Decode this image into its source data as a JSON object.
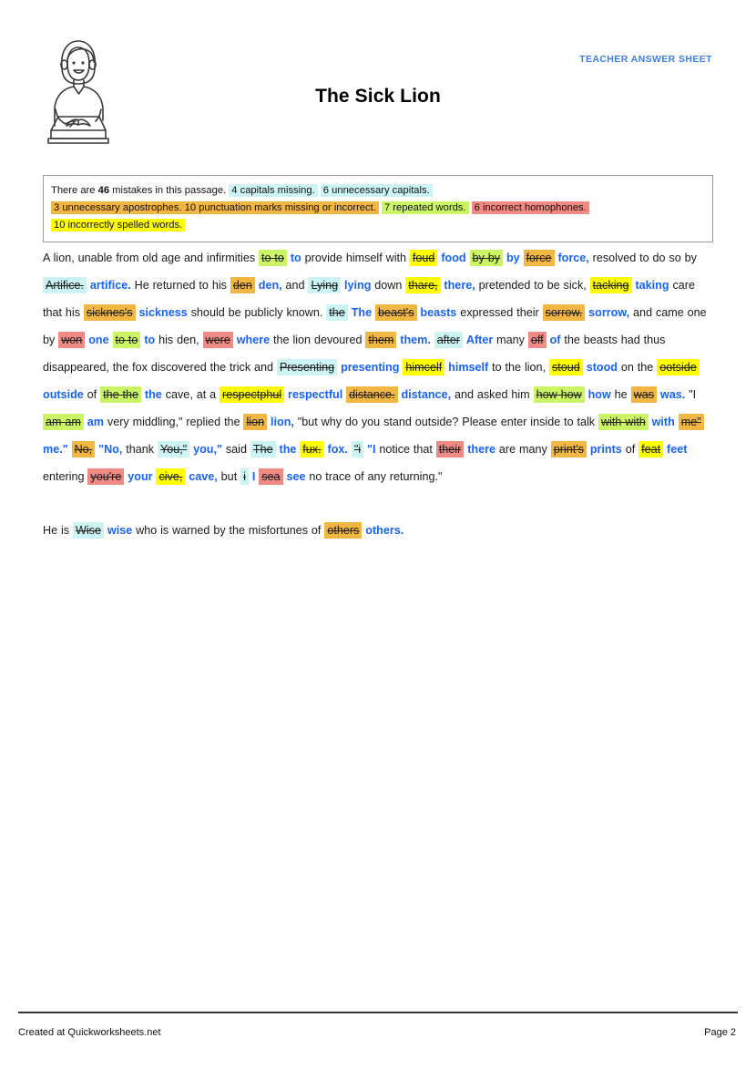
{
  "header": {
    "answer_sheet_label": "TEACHER ANSWER SHEET",
    "title": "The Sick Lion",
    "illustration_name": "teacher-writing-at-desk"
  },
  "legend": {
    "intro_prefix": "There are ",
    "mistake_count": "46",
    "intro_suffix": " mistakes in this passage. ",
    "items": [
      {
        "text": "4 capitals missing.",
        "color": "#cdf4f4",
        "style": "hl-cap-missing"
      },
      {
        "text": "6 unnecessary capitals.",
        "color": "#cdf4f4",
        "style": "hl-cap-extra"
      },
      {
        "text": "3 unnecessary apostrophes. 10 punctuation marks missing or incorrect.",
        "color": "#f2b743",
        "style": "hl-punct"
      },
      {
        "text": "7 repeated words.",
        "color": "#ccf566",
        "style": "hl-repeat"
      },
      {
        "text": "6 incorrect homophones.",
        "color": "#f08a84",
        "style": "hl-homophone"
      },
      {
        "text": "10 incorrectly spelled words.",
        "color": "#ffff00",
        "style": "hl-spelling"
      }
    ]
  },
  "passage": {
    "paragraph_1": [
      {
        "kind": "text",
        "text": "A lion, unable from old age and infirmities "
      },
      {
        "kind": "error",
        "text": "to to",
        "style": "hl-repeat"
      },
      {
        "kind": "text",
        "text": " "
      },
      {
        "kind": "fix",
        "text": "to"
      },
      {
        "kind": "text",
        "text": " provide himself with "
      },
      {
        "kind": "error",
        "text": "foud",
        "style": "hl-spelling"
      },
      {
        "kind": "text",
        "text": " "
      },
      {
        "kind": "fix",
        "text": "food"
      },
      {
        "kind": "text",
        "text": " "
      },
      {
        "kind": "error",
        "text": "by by",
        "style": "hl-repeat"
      },
      {
        "kind": "text",
        "text": " "
      },
      {
        "kind": "fix",
        "text": "by"
      },
      {
        "kind": "text",
        "text": " "
      },
      {
        "kind": "error",
        "text": "force",
        "style": "hl-punct"
      },
      {
        "kind": "text",
        "text": " "
      },
      {
        "kind": "fix",
        "text": "force,"
      },
      {
        "kind": "text",
        "text": " resolved to do so by "
      },
      {
        "kind": "error",
        "text": "Artifice.",
        "style": "hl-cap-extra"
      },
      {
        "kind": "text",
        "text": " "
      },
      {
        "kind": "fix",
        "text": "artifice."
      },
      {
        "kind": "text",
        "text": " He returned to his "
      },
      {
        "kind": "error",
        "text": "den",
        "style": "hl-punct"
      },
      {
        "kind": "text",
        "text": " "
      },
      {
        "kind": "fix",
        "text": "den,"
      },
      {
        "kind": "text",
        "text": " and "
      },
      {
        "kind": "error",
        "text": "Lying",
        "style": "hl-cap-extra"
      },
      {
        "kind": "text",
        "text": " "
      },
      {
        "kind": "fix",
        "text": "lying"
      },
      {
        "kind": "text",
        "text": " down "
      },
      {
        "kind": "error",
        "text": "thare,",
        "style": "hl-spelling"
      },
      {
        "kind": "text",
        "text": " "
      },
      {
        "kind": "fix",
        "text": "there,"
      },
      {
        "kind": "text",
        "text": " pretended to be sick, "
      },
      {
        "kind": "error",
        "text": "tacking",
        "style": "hl-spelling"
      },
      {
        "kind": "text",
        "text": " "
      },
      {
        "kind": "fix",
        "text": "taking"
      },
      {
        "kind": "text",
        "text": " care that his "
      },
      {
        "kind": "error",
        "text": "sicknes's",
        "style": "hl-apos"
      },
      {
        "kind": "text",
        "text": " "
      },
      {
        "kind": "fix",
        "text": "sickness"
      },
      {
        "kind": "text",
        "text": " should be publicly known. "
      },
      {
        "kind": "error",
        "text": "the",
        "style": "hl-cap-missing"
      },
      {
        "kind": "text",
        "text": " "
      },
      {
        "kind": "fix",
        "text": "The"
      },
      {
        "kind": "text",
        "text": " "
      },
      {
        "kind": "error",
        "text": "beast's",
        "style": "hl-apos"
      },
      {
        "kind": "text",
        "text": " "
      },
      {
        "kind": "fix",
        "text": "beasts"
      },
      {
        "kind": "text",
        "text": " expressed their "
      },
      {
        "kind": "error",
        "text": "sorrow.",
        "style": "hl-punct"
      },
      {
        "kind": "text",
        "text": " "
      },
      {
        "kind": "fix",
        "text": "sorrow,"
      },
      {
        "kind": "text",
        "text": " and came one by "
      },
      {
        "kind": "error",
        "text": "won",
        "style": "hl-homophone"
      },
      {
        "kind": "text",
        "text": " "
      },
      {
        "kind": "fix",
        "text": "one"
      },
      {
        "kind": "text",
        "text": " "
      },
      {
        "kind": "error",
        "text": "to to",
        "style": "hl-repeat"
      },
      {
        "kind": "text",
        "text": " "
      },
      {
        "kind": "fix",
        "text": "to"
      },
      {
        "kind": "text",
        "text": " his den, "
      },
      {
        "kind": "error",
        "text": "were",
        "style": "hl-homophone"
      },
      {
        "kind": "text",
        "text": " "
      },
      {
        "kind": "fix",
        "text": "where"
      },
      {
        "kind": "text",
        "text": " the lion devoured "
      },
      {
        "kind": "error",
        "text": "them",
        "style": "hl-punct"
      },
      {
        "kind": "text",
        "text": " "
      },
      {
        "kind": "fix",
        "text": "them."
      },
      {
        "kind": "text",
        "text": " "
      },
      {
        "kind": "error",
        "text": "after",
        "style": "hl-cap-missing"
      },
      {
        "kind": "text",
        "text": " "
      },
      {
        "kind": "fix",
        "text": "After"
      },
      {
        "kind": "text",
        "text": " many "
      },
      {
        "kind": "error",
        "text": "off",
        "style": "hl-homophone"
      },
      {
        "kind": "text",
        "text": " "
      },
      {
        "kind": "fix",
        "text": "of"
      },
      {
        "kind": "text",
        "text": " the beasts had thus disappeared, the fox discovered the trick and "
      },
      {
        "kind": "error",
        "text": "Presenting",
        "style": "hl-cap-extra"
      },
      {
        "kind": "text",
        "text": " "
      },
      {
        "kind": "fix",
        "text": "presenting"
      },
      {
        "kind": "text",
        "text": " "
      },
      {
        "kind": "error",
        "text": "himcelf",
        "style": "hl-spelling"
      },
      {
        "kind": "text",
        "text": " "
      },
      {
        "kind": "fix",
        "text": "himself"
      },
      {
        "kind": "text",
        "text": " to the lion, "
      },
      {
        "kind": "error",
        "text": "stoud",
        "style": "hl-spelling"
      },
      {
        "kind": "text",
        "text": " "
      },
      {
        "kind": "fix",
        "text": "stood"
      },
      {
        "kind": "text",
        "text": " on the "
      },
      {
        "kind": "error",
        "text": "ootside",
        "style": "hl-spelling"
      },
      {
        "kind": "text",
        "text": " "
      },
      {
        "kind": "fix",
        "text": "outside"
      },
      {
        "kind": "text",
        "text": " of "
      },
      {
        "kind": "error",
        "text": "the the",
        "style": "hl-repeat"
      },
      {
        "kind": "text",
        "text": " "
      },
      {
        "kind": "fix",
        "text": "the"
      },
      {
        "kind": "text",
        "text": " cave, at a "
      },
      {
        "kind": "error",
        "text": "respectphul",
        "style": "hl-spelling"
      },
      {
        "kind": "text",
        "text": " "
      },
      {
        "kind": "fix",
        "text": "respectful"
      },
      {
        "kind": "text",
        "text": " "
      },
      {
        "kind": "error",
        "text": "distance.",
        "style": "hl-punct"
      },
      {
        "kind": "text",
        "text": " "
      },
      {
        "kind": "fix",
        "text": "distance,"
      },
      {
        "kind": "text",
        "text": " and asked him "
      },
      {
        "kind": "error",
        "text": "how how",
        "style": "hl-repeat"
      },
      {
        "kind": "text",
        "text": " "
      },
      {
        "kind": "fix",
        "text": "how"
      },
      {
        "kind": "text",
        "text": " he "
      },
      {
        "kind": "error",
        "text": "was",
        "style": "hl-punct"
      },
      {
        "kind": "text",
        "text": " "
      },
      {
        "kind": "fix",
        "text": "was."
      },
      {
        "kind": "text",
        "text": " \"I "
      },
      {
        "kind": "error",
        "text": "am am",
        "style": "hl-repeat"
      },
      {
        "kind": "text",
        "text": " "
      },
      {
        "kind": "fix",
        "text": "am"
      },
      {
        "kind": "text",
        "text": " very middling,\" replied the "
      },
      {
        "kind": "error",
        "text": "lion",
        "style": "hl-punct"
      },
      {
        "kind": "text",
        "text": " "
      },
      {
        "kind": "fix",
        "text": "lion,"
      },
      {
        "kind": "text",
        "text": " \"but why do you stand outside? Please enter inside to talk "
      },
      {
        "kind": "error",
        "text": "with with",
        "style": "hl-repeat"
      },
      {
        "kind": "text",
        "text": " "
      },
      {
        "kind": "fix",
        "text": "with"
      },
      {
        "kind": "text",
        "text": " "
      },
      {
        "kind": "error",
        "text": "me\"",
        "style": "hl-punct"
      },
      {
        "kind": "text",
        "text": " "
      },
      {
        "kind": "fix",
        "text": "me.\""
      },
      {
        "kind": "text",
        "text": " "
      },
      {
        "kind": "error",
        "text": "No,",
        "style": "hl-punct"
      },
      {
        "kind": "text",
        "text": " "
      },
      {
        "kind": "fix",
        "text": "\"No,"
      },
      {
        "kind": "text",
        "text": " thank "
      },
      {
        "kind": "error",
        "text": "You,\"",
        "style": "hl-cap-extra"
      },
      {
        "kind": "text",
        "text": " "
      },
      {
        "kind": "fix",
        "text": "you,\""
      },
      {
        "kind": "text",
        "text": " said "
      },
      {
        "kind": "error",
        "text": "The",
        "style": "hl-cap-extra"
      },
      {
        "kind": "text",
        "text": " "
      },
      {
        "kind": "fix",
        "text": "the"
      },
      {
        "kind": "text",
        "text": " "
      },
      {
        "kind": "error",
        "text": "fux.",
        "style": "hl-spelling"
      },
      {
        "kind": "text",
        "text": " "
      },
      {
        "kind": "fix",
        "text": "fox."
      },
      {
        "kind": "text",
        "text": " "
      },
      {
        "kind": "error",
        "text": "\"i",
        "style": "hl-cap-missing"
      },
      {
        "kind": "text",
        "text": " "
      },
      {
        "kind": "fix",
        "text": "\"I"
      },
      {
        "kind": "text",
        "text": " notice that "
      },
      {
        "kind": "error",
        "text": "their",
        "style": "hl-homophone"
      },
      {
        "kind": "text",
        "text": " "
      },
      {
        "kind": "fix",
        "text": "there"
      },
      {
        "kind": "text",
        "text": " are many "
      },
      {
        "kind": "error",
        "text": "print's",
        "style": "hl-apos"
      },
      {
        "kind": "text",
        "text": " "
      },
      {
        "kind": "fix",
        "text": "prints"
      },
      {
        "kind": "text",
        "text": " of "
      },
      {
        "kind": "error",
        "text": "feat",
        "style": "hl-spelling"
      },
      {
        "kind": "text",
        "text": " "
      },
      {
        "kind": "fix",
        "text": "feet"
      },
      {
        "kind": "text",
        "text": " entering "
      },
      {
        "kind": "error",
        "text": "you're",
        "style": "hl-homophone"
      },
      {
        "kind": "text",
        "text": " "
      },
      {
        "kind": "fix",
        "text": "your"
      },
      {
        "kind": "text",
        "text": " "
      },
      {
        "kind": "error",
        "text": "cive,",
        "style": "hl-spelling"
      },
      {
        "kind": "text",
        "text": " "
      },
      {
        "kind": "fix",
        "text": "cave,"
      },
      {
        "kind": "text",
        "text": " but "
      },
      {
        "kind": "error",
        "text": "i",
        "style": "hl-cap-missing"
      },
      {
        "kind": "text",
        "text": " "
      },
      {
        "kind": "fix",
        "text": "I"
      },
      {
        "kind": "text",
        "text": " "
      },
      {
        "kind": "error",
        "text": "sea",
        "style": "hl-homophone"
      },
      {
        "kind": "text",
        "text": " "
      },
      {
        "kind": "fix",
        "text": "see"
      },
      {
        "kind": "text",
        "text": " no trace of any returning.\""
      }
    ],
    "paragraph_2": [
      {
        "kind": "text",
        "text": "He is "
      },
      {
        "kind": "error",
        "text": "Wise",
        "style": "hl-cap-extra"
      },
      {
        "kind": "text",
        "text": " "
      },
      {
        "kind": "fix",
        "text": "wise"
      },
      {
        "kind": "text",
        "text": " who is warned by the misfortunes of "
      },
      {
        "kind": "error",
        "text": "others",
        "style": "hl-punct"
      },
      {
        "kind": "text",
        "text": " "
      },
      {
        "kind": "fix",
        "text": "others."
      }
    ]
  },
  "footer": {
    "created_at": "Created at Quickworksheets.net",
    "page_label": "Page 2"
  },
  "colors": {
    "accent_blue": "#1763f5",
    "header_blue": "#3b7fe8",
    "capitals": "#cdf4f4",
    "apostrophes_punctuation": "#f2b743",
    "repeated": "#ccf566",
    "homophones": "#f08a84",
    "spelling": "#ffff00"
  }
}
